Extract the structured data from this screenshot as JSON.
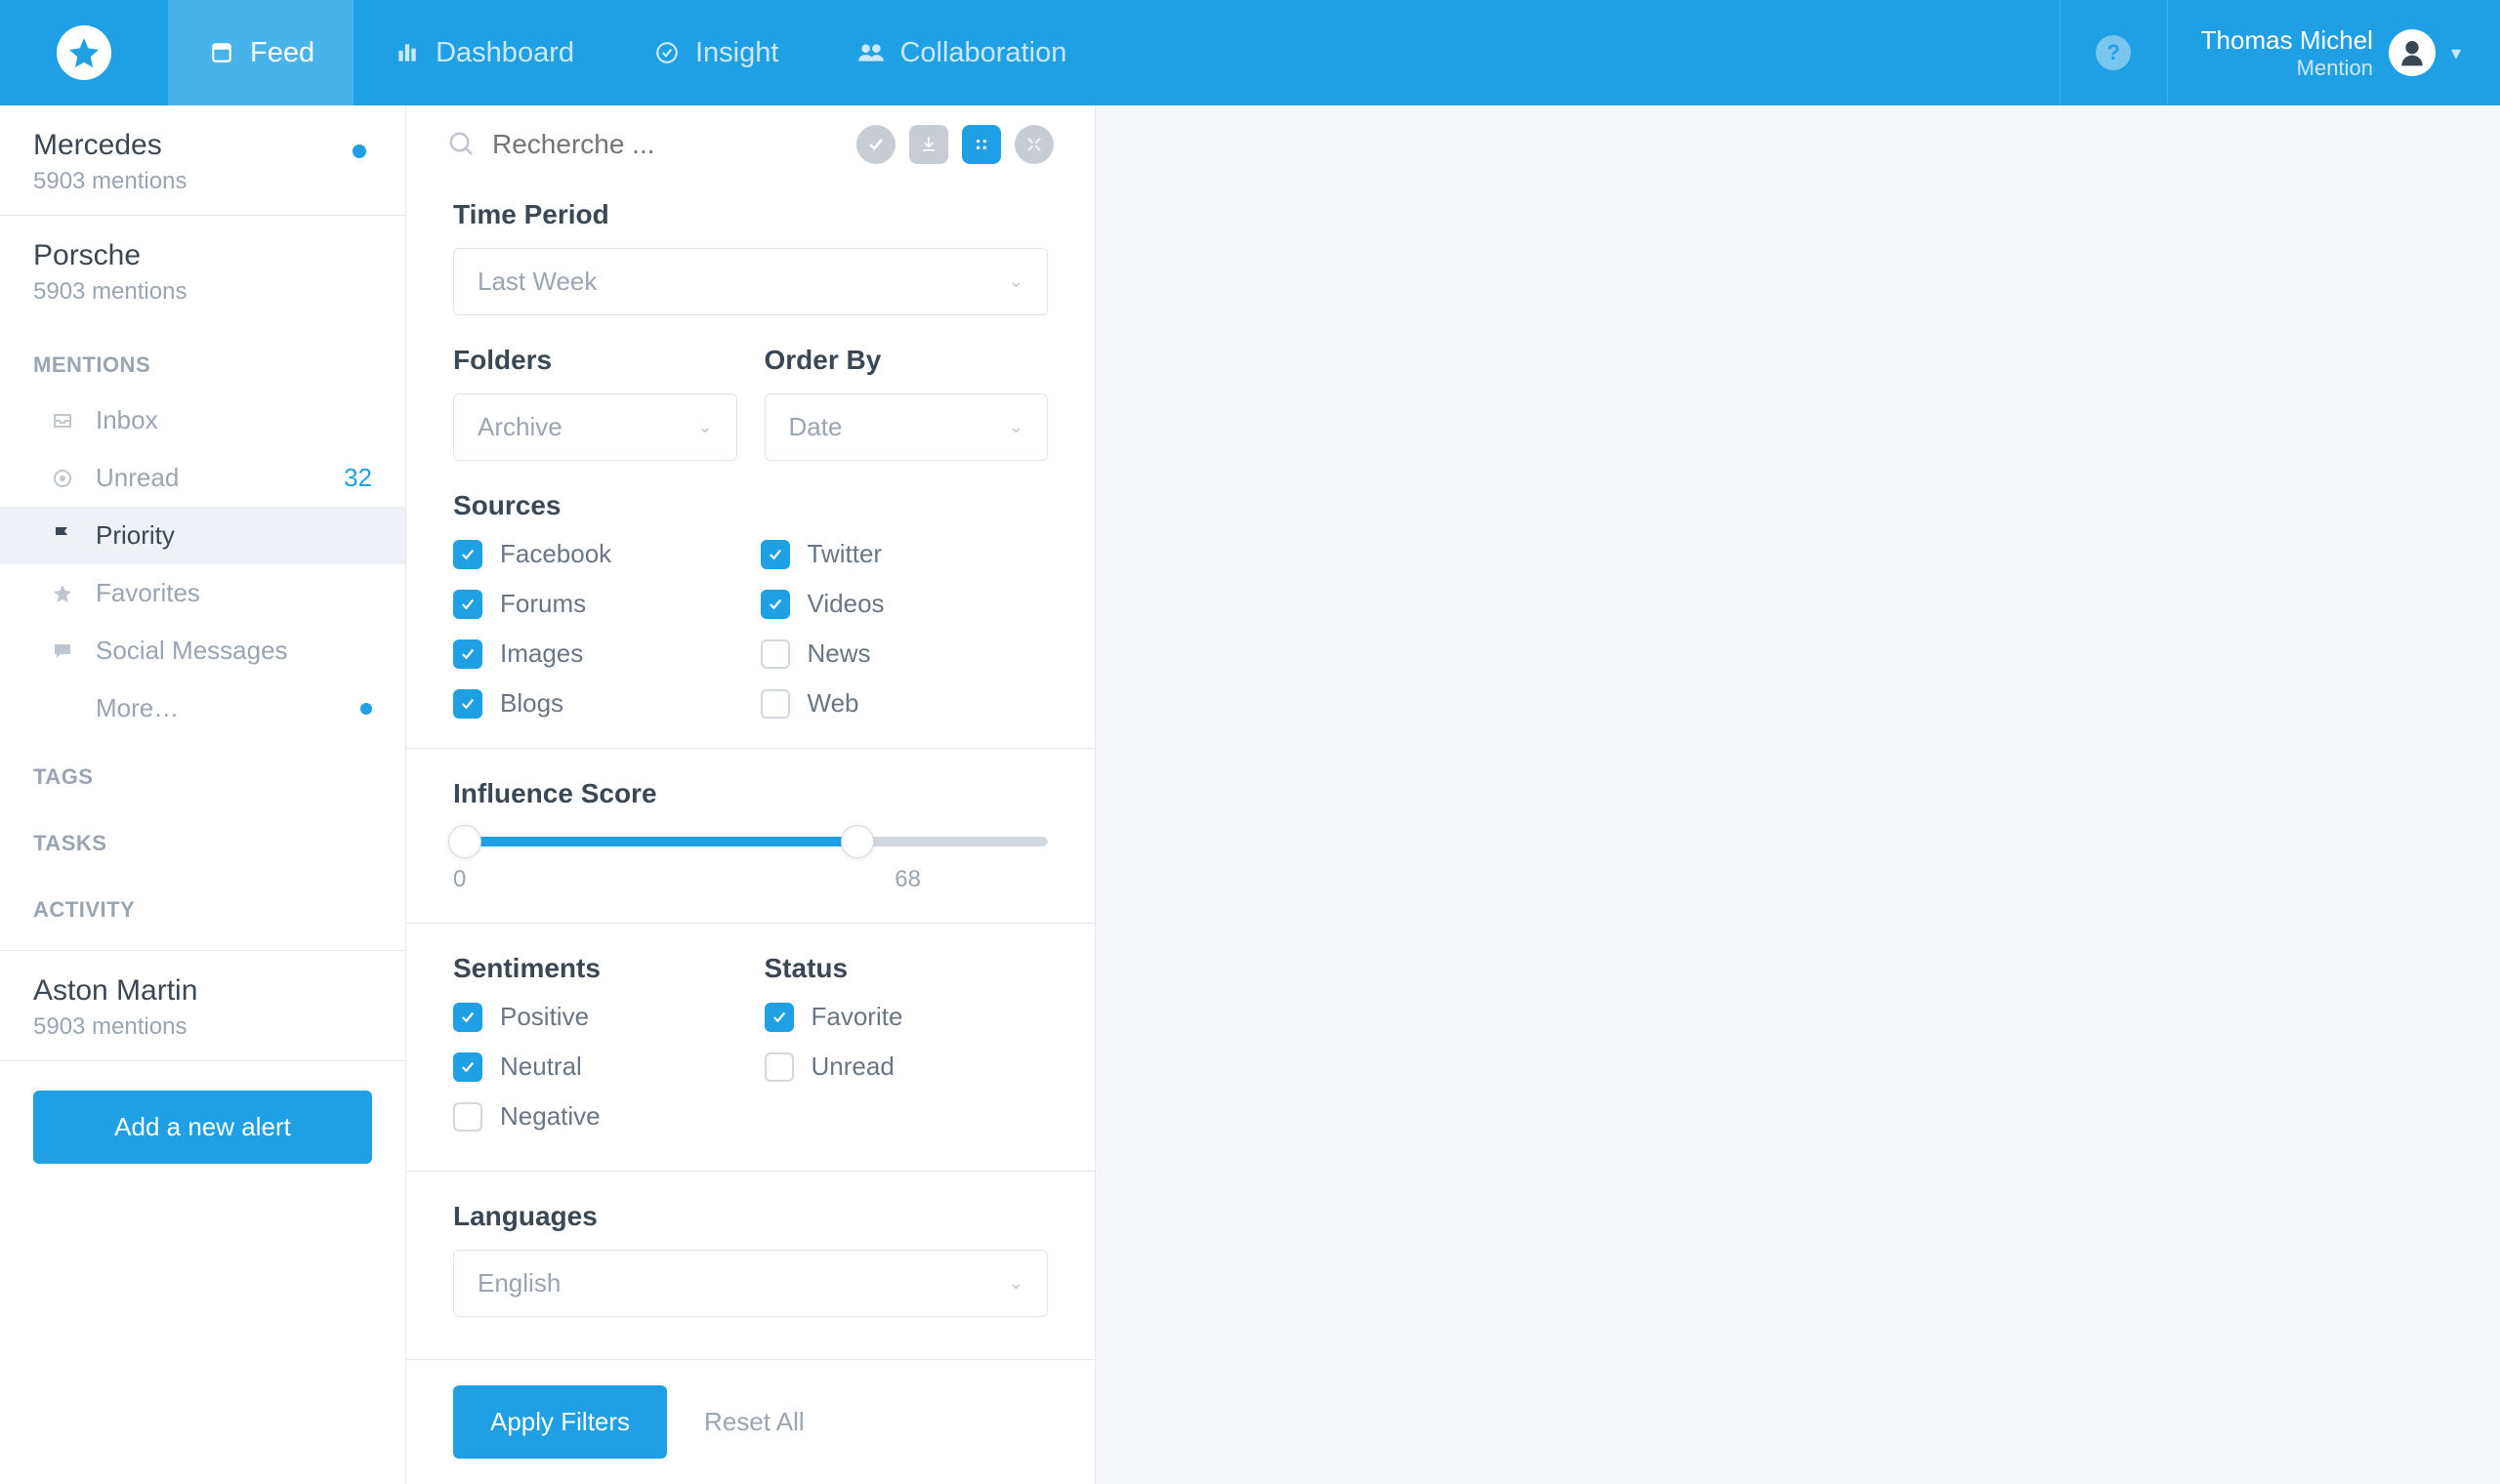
{
  "topbar": {
    "nav": [
      {
        "label": "Feed",
        "icon": "feed"
      },
      {
        "label": "Dashboard",
        "icon": "dashboard"
      },
      {
        "label": "Insight",
        "icon": "insight"
      },
      {
        "label": "Collaboration",
        "icon": "collab"
      }
    ],
    "user_name": "Thomas Michel",
    "user_sub": "Mention"
  },
  "sidebar": {
    "alerts": [
      {
        "title": "Mercedes",
        "sub": "5903 mentions",
        "dot": true
      },
      {
        "title": "Porsche",
        "sub": "5903 mentions",
        "dot": false
      }
    ],
    "sections": {
      "mentions": "MENTIONS",
      "tags": "TAGS",
      "tasks": "TASKS",
      "activity": "ACTIVITY"
    },
    "menu": [
      {
        "label": "Inbox",
        "icon": "inbox"
      },
      {
        "label": "Unread",
        "icon": "unread",
        "badge": "32"
      },
      {
        "label": "Priority",
        "icon": "flag",
        "active": true
      },
      {
        "label": "Favorites",
        "icon": "star"
      },
      {
        "label": "Social Messages",
        "icon": "chat"
      },
      {
        "label": "More…",
        "icon": "",
        "dot": true
      }
    ],
    "alert3": {
      "title": "Aston Martin",
      "sub": "5903 mentions"
    },
    "add_alert": "Add a new alert"
  },
  "filters": {
    "search_placeholder": "Recherche ...",
    "time_period": {
      "title": "Time Period",
      "value": "Last Week"
    },
    "folders": {
      "title": "Folders",
      "value": "Archive"
    },
    "order_by": {
      "title": "Order By",
      "value": "Date"
    },
    "sources": {
      "title": "Sources",
      "items": [
        {
          "label": "Facebook",
          "checked": true
        },
        {
          "label": "Twitter",
          "checked": true
        },
        {
          "label": "Forums",
          "checked": true
        },
        {
          "label": "Videos",
          "checked": true
        },
        {
          "label": "Images",
          "checked": true
        },
        {
          "label": "News",
          "checked": false
        },
        {
          "label": "Blogs",
          "checked": true
        },
        {
          "label": "Web",
          "checked": false
        }
      ]
    },
    "influence": {
      "title": "Influence Score",
      "min": "0",
      "max": "68",
      "pct": 68
    },
    "sentiments": {
      "title": "Sentiments",
      "items": [
        {
          "label": "Positive",
          "checked": true
        },
        {
          "label": "Neutral",
          "checked": true
        },
        {
          "label": "Negative",
          "checked": false
        }
      ]
    },
    "status": {
      "title": "Status",
      "items": [
        {
          "label": "Favorite",
          "checked": true
        },
        {
          "label": "Unread",
          "checked": false
        }
      ]
    },
    "languages": {
      "title": "Languages",
      "value": "English"
    },
    "apply": "Apply Filters",
    "reset": "Reset All"
  }
}
